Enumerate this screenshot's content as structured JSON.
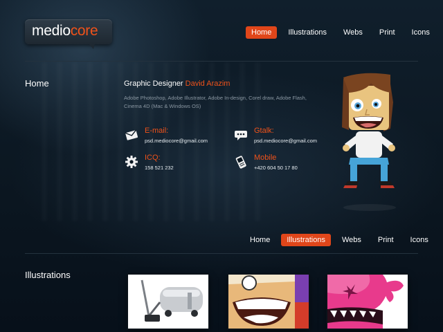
{
  "logo": {
    "part1": "medio",
    "part2": "core"
  },
  "top_nav": [
    {
      "label": "Home",
      "active": true
    },
    {
      "label": "Illustrations",
      "active": false
    },
    {
      "label": "Webs",
      "active": false
    },
    {
      "label": "Print",
      "active": false
    },
    {
      "label": "Icons",
      "active": false
    }
  ],
  "home": {
    "section_title": "Home",
    "headline_prefix": "Graphic Designer ",
    "headline_name": "David Arazim",
    "skills": "Adobe Photoshop, Adobe Illustrator, Adobe In-design, Corel draw, Adobe Flash, Cinema 4D (Mac & Windows OS)",
    "contacts": [
      {
        "label": "E-mail:",
        "value": "psd.mediocore@gmail.com",
        "icon": "envelope-icon"
      },
      {
        "label": "Gtalk:",
        "value": "psd.mediocore@gmail.com",
        "icon": "chat-bubble-icon"
      },
      {
        "label": "ICQ:",
        "value": "158 521 232",
        "icon": "gear-icon"
      },
      {
        "label": "Mobile",
        "value": "+420 604 50 17 80",
        "icon": "mobile-phone-icon"
      }
    ]
  },
  "second_nav": [
    {
      "label": "Home",
      "active": false
    },
    {
      "label": "Illustrations",
      "active": true
    },
    {
      "label": "Webs",
      "active": false
    },
    {
      "label": "Print",
      "active": false
    },
    {
      "label": "Icons",
      "active": false
    }
  ],
  "illustrations": {
    "section_title": "Illustrations",
    "thumbnails": [
      "vacuum-cleaner-illustration",
      "laughing-man-illustration",
      "pink-monster-illustration"
    ]
  },
  "colors": {
    "accent": "#e0461a",
    "background": "#0c1822",
    "text": "#ffffff",
    "muted": "#8b98a3"
  }
}
